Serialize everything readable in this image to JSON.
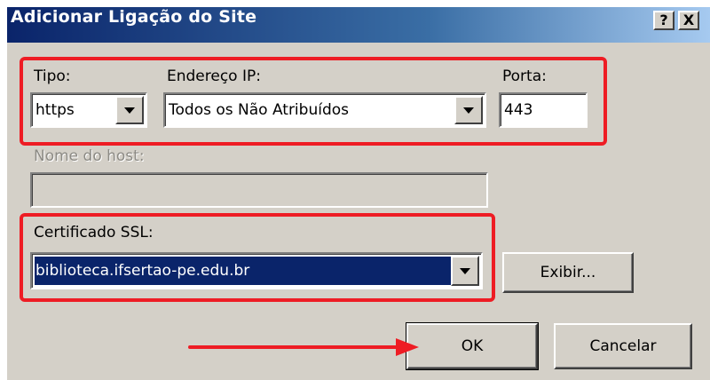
{
  "window": {
    "title": "Adicionar Ligação do Site",
    "help_label": "?",
    "close_label": "X"
  },
  "form": {
    "tipo_label": "Tipo:",
    "tipo_value": "https",
    "ip_label": "Endereço IP:",
    "ip_value": "Todos os Não Atribuídos",
    "porta_label": "Porta:",
    "porta_value": "443",
    "host_label": "Nome do host:",
    "host_value": "",
    "ssl_label": "Certificado SSL:",
    "ssl_value": "biblioteca.ifsertao-pe.edu.br",
    "view_button": "Exibir...",
    "ok_button": "OK",
    "cancel_button": "Cancelar"
  },
  "annotation": {
    "color": "#ee1c24"
  },
  "colors": {
    "titlebar_start": "#0a246a",
    "titlebar_end": "#a6caf0",
    "dialog_bg": "#d4d0c8",
    "selection": "#0a246a"
  }
}
